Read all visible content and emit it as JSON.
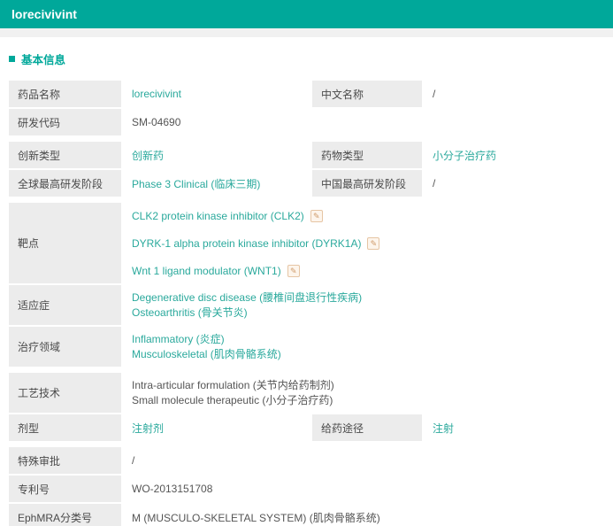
{
  "page": {
    "title": "lorecivivint"
  },
  "section": {
    "title": "基本信息"
  },
  "colors": {
    "accent": "#00a89a",
    "link": "#2aa99c",
    "label_bg": "#ececec",
    "icon_border": "#e6c5a4",
    "icon_glyph": "#cf9a6a"
  },
  "icons": {
    "edit": "✎"
  },
  "rows": {
    "drug_name": {
      "label": "药品名称",
      "value": "lorecivivint"
    },
    "cn_name": {
      "label": "中文名称",
      "value": "/"
    },
    "rd_code": {
      "label": "研发代码",
      "value": "SM-04690"
    },
    "innovation_type": {
      "label": "创新类型",
      "value": "创新药"
    },
    "drug_type": {
      "label": "药物类型",
      "value": "小分子治疗药"
    },
    "global_stage": {
      "label": "全球最高研发阶段",
      "value": "Phase 3 Clinical  (临床三期)"
    },
    "china_stage": {
      "label": "中国最高研发阶段",
      "value": "/"
    },
    "targets": {
      "label": "靶点",
      "items": [
        "CLK2 protein kinase inhibitor  (CLK2)",
        "DYRK-1 alpha protein kinase inhibitor  (DYRK1A)",
        "Wnt 1 ligand modulator  (WNT1)"
      ]
    },
    "indications": {
      "label": "适应症",
      "items": [
        "Degenerative disc disease  (腰椎间盘退行性疾病)",
        "Osteoarthritis  (骨关节炎)"
      ]
    },
    "therapy_areas": {
      "label": "治疗领域",
      "items": [
        "Inflammatory  (炎症)",
        "Musculoskeletal  (肌肉骨骼系统)"
      ]
    },
    "technology": {
      "label": "工艺技术",
      "items": [
        "Intra-articular formulation  (关节内给药制剂)",
        "Small molecule therapeutic  (小分子治疗药)"
      ]
    },
    "dosage_form": {
      "label": "剂型",
      "value": "注射剂"
    },
    "admin_route": {
      "label": "给药途径",
      "value": "注射"
    },
    "special_approval": {
      "label": "特殊审批",
      "value": "/"
    },
    "patent_no": {
      "label": "专利号",
      "value": "WO-2013151708"
    },
    "ephmra": {
      "label": "EphMRA分类号",
      "value": "M (MUSCULO-SKELETAL SYSTEM)  (肌肉骨骼系统)"
    }
  }
}
